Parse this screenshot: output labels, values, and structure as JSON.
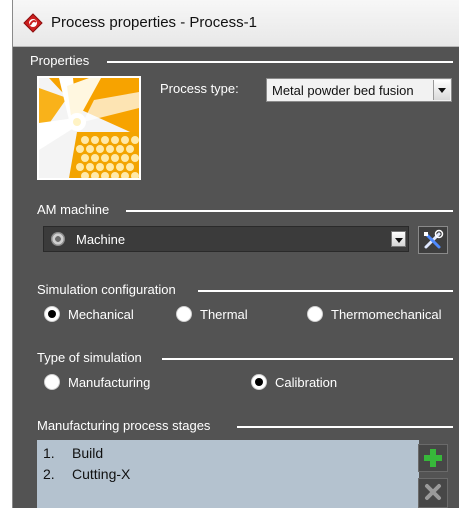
{
  "window": {
    "title": "Process properties - Process-1"
  },
  "properties": {
    "section_label": "Properties",
    "process_type_label": "Process type:",
    "process_type_value": "Metal powder bed fusion"
  },
  "am_machine": {
    "section_label": "AM machine",
    "machine_value": "Machine"
  },
  "simulation_configuration": {
    "section_label": "Simulation configuration",
    "options": [
      {
        "label": "Mechanical",
        "checked": true
      },
      {
        "label": "Thermal",
        "checked": false
      },
      {
        "label": "Thermomechanical",
        "checked": false
      }
    ]
  },
  "type_of_simulation": {
    "section_label": "Type of simulation",
    "options": [
      {
        "label": "Manufacturing",
        "checked": false
      },
      {
        "label": "Calibration",
        "checked": true
      }
    ]
  },
  "stages": {
    "section_label": "Manufacturing process stages",
    "items": [
      {
        "number": "1.",
        "name": "Build"
      },
      {
        "number": "2.",
        "name": "Cutting-X"
      }
    ]
  },
  "colors": {
    "panel": "#535353",
    "list_background": "#b4c2cf",
    "add_green": "#37b83a",
    "image_orange": "#f7a300"
  },
  "icons": {
    "app": "red-gear-icon",
    "tool": "tools-icon",
    "add": "plus-icon",
    "remove": "close-icon"
  }
}
